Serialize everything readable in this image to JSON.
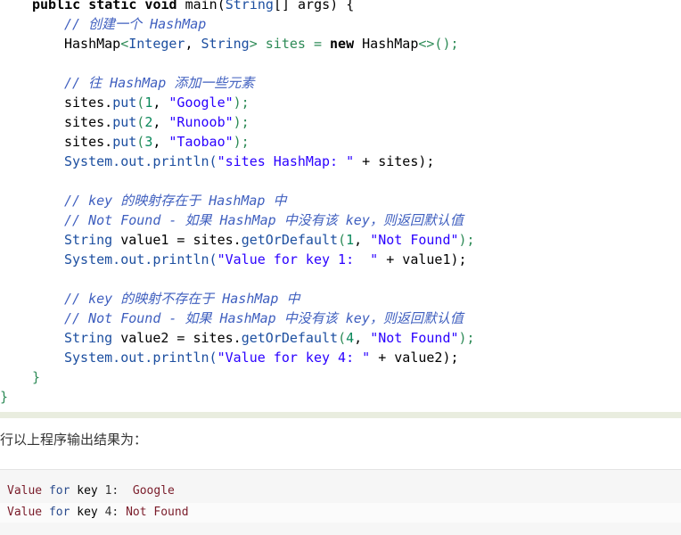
{
  "code": {
    "l1": {
      "a": "public static void",
      "b": " main(",
      "c": "String",
      "d": "[] args) {"
    },
    "l2": "// 创建一个 HashMap",
    "l3": {
      "a": "HashMap",
      "b": "<",
      "c": "Integer",
      "d": ", ",
      "e": "String",
      "f": "> sites = ",
      "g": "new",
      "h": " HashMap",
      "i": "<>();"
    },
    "l5": "// 往 HashMap 添加一些元素",
    "l6": {
      "a": "sites.",
      "b": "put",
      "c": "(",
      "d": "1",
      "e": ", ",
      "f": "\"Google\"",
      "g": ");"
    },
    "l7": {
      "a": "sites.",
      "b": "put",
      "c": "(",
      "d": "2",
      "e": ", ",
      "f": "\"Runoob\"",
      "g": ");"
    },
    "l8": {
      "a": "sites.",
      "b": "put",
      "c": "(",
      "d": "3",
      "e": ", ",
      "f": "\"Taobao\"",
      "g": ");"
    },
    "l9": {
      "a": "System.out.println(",
      "b": "\"sites HashMap: \"",
      "c": " + sites);"
    },
    "l11": "// key 的映射存在于 HashMap 中",
    "l12": "// Not Found - 如果 HashMap 中没有该 key，则返回默认值",
    "l13": {
      "a": "String",
      "b": " value1 = sites.",
      "c": "getOrDefault",
      "d": "(",
      "e": "1",
      "f": ", ",
      "g": "\"Not Found\"",
      "h": ");"
    },
    "l14": {
      "a": "System.out.println(",
      "b": "\"Value for key 1:  \"",
      "c": " + value1);"
    },
    "l16": "// key 的映射不存在于 HashMap 中",
    "l17": "// Not Found - 如果 HashMap 中没有该 key，则返回默认值",
    "l18": {
      "a": "String",
      "b": " value2 = sites.",
      "c": "getOrDefault",
      "d": "(",
      "e": "4",
      "f": ", ",
      "g": "\"Not Found\"",
      "h": ");"
    },
    "l19": {
      "a": "System.out.println(",
      "b": "\"Value for key 4: \"",
      "c": " + value2);"
    },
    "l20": "}",
    "l21": "}"
  },
  "result_label": "行以上程序输出结果为：",
  "output": {
    "row1": {
      "a": "Value ",
      "b": "for",
      "c": " ",
      "d": "key",
      "e": " 1:  ",
      "f": "Google"
    },
    "row2": {
      "a": "Value ",
      "b": "for",
      "c": " ",
      "d": "key",
      "e": " 4: ",
      "f": "Not Found"
    }
  }
}
